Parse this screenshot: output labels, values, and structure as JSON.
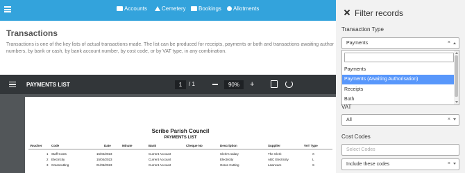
{
  "nav": {
    "items": [
      {
        "label": "Accounts",
        "icon": "money-icon"
      },
      {
        "label": "Cemetery",
        "icon": "cemetery-icon"
      },
      {
        "label": "Bookings",
        "icon": "calendar-icon"
      },
      {
        "label": "Allotments",
        "icon": "allotment-icon"
      }
    ]
  },
  "content": {
    "title": "Transactions",
    "description_line1": "Transactions is one of the key lists of actual transactions made. The list can be produced for receipts, payments or both and transactions awaiting author",
    "description_line2": "numbers, by bank or cash, by bank account number, by cost code, or by VAT type, in any combination."
  },
  "viewer": {
    "title": "PAYMENTS LIST",
    "page_current": "1",
    "page_total": "/ 1",
    "zoom": "90%"
  },
  "document": {
    "council": "Scribe Parish Council",
    "heading": "PAYMENTS LIST",
    "columns": [
      "Voucher",
      "Code",
      "Date",
      "Minute",
      "Bank",
      "Cheque No",
      "Description",
      "Supplier",
      "VAT Type"
    ],
    "rows": [
      [
        "1",
        "Staff Costs",
        "15/04/2023",
        "",
        "Current Account",
        "",
        "Clerk's salary",
        "The Clerk",
        "X"
      ],
      [
        "2",
        "Electricity",
        "15/04/2023",
        "",
        "Current Account",
        "",
        "Electricity",
        "ABC Electricity",
        "L"
      ],
      [
        "3",
        "Grasscutting",
        "01/05/2023",
        "",
        "Current Account",
        "",
        "Grass Cutting",
        "Lawncare",
        "S"
      ]
    ]
  },
  "panel": {
    "title": "Filter records",
    "transaction_type_label": "Transaction Type",
    "transaction_type_value": "Payments",
    "clear_glyph": "×",
    "options": [
      "Payments",
      "Payments (Awaiting Authorisation)",
      "Receipts",
      "Both"
    ],
    "highlighted_option": 1,
    "vat_label": "VAT",
    "vat_value": "All",
    "cost_codes_label": "Cost Codes",
    "cost_codes_placeholder": "Select Codes",
    "cost_codes_mode": "Include these codes"
  },
  "colors": {
    "topbar": "#33a3dc",
    "highlight": "#5897fb",
    "viewer_bar": "#323639"
  }
}
